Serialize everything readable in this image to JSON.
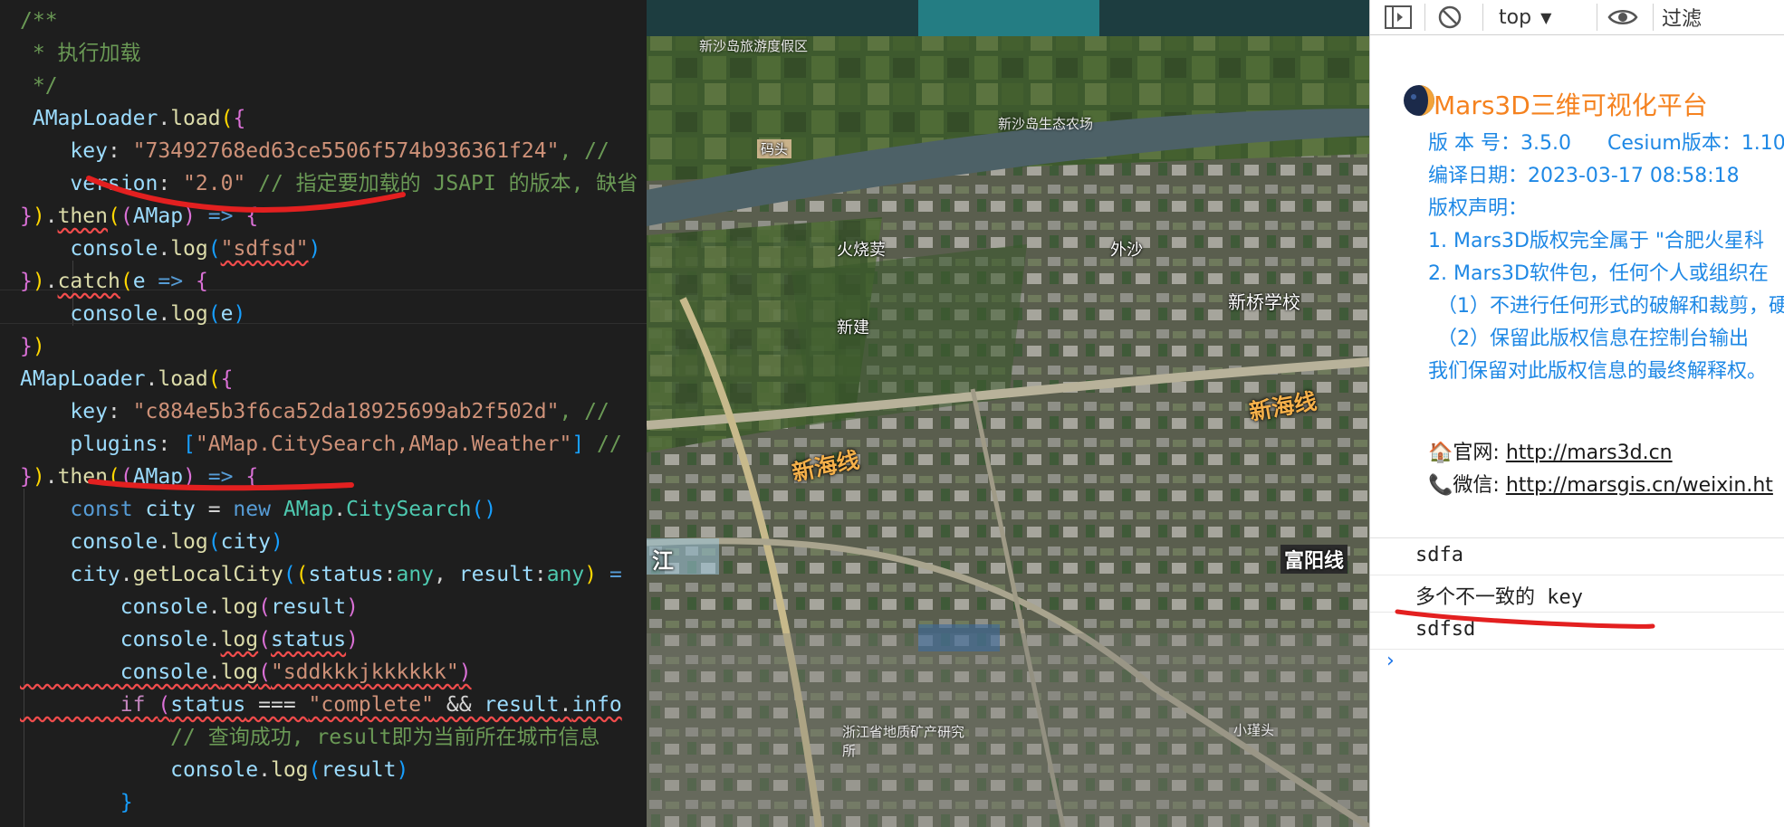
{
  "editor": {
    "lines": [
      [
        {
          "t": "/**",
          "c": "c-com"
        }
      ],
      [
        {
          "t": " * 执行加载",
          "c": "c-com"
        }
      ],
      [
        {
          "t": " */",
          "c": "c-com"
        }
      ],
      [
        {
          "t": " AMapLoader",
          "c": "c-var"
        },
        {
          "t": ".",
          "c": "c-op"
        },
        {
          "t": "load",
          "c": "c-fn"
        },
        {
          "t": "(",
          "c": "c-b1"
        },
        {
          "t": "{",
          "c": "c-b2"
        }
      ],
      [
        {
          "t": "    key",
          "c": "c-var"
        },
        {
          "t": ": ",
          "c": "c-op"
        },
        {
          "t": "\"73492768ed63ce5506f574b936361f24\"",
          "c": "c-str"
        },
        {
          "t": ", //",
          "c": "c-com"
        }
      ],
      [
        {
          "t": "    version",
          "c": "c-var"
        },
        {
          "t": ": ",
          "c": "c-op"
        },
        {
          "t": "\"2.0\"",
          "c": "c-str"
        },
        {
          "t": " // 指定要加载的 JSAPI 的版本, 缺省",
          "c": "c-com"
        }
      ],
      [
        {
          "t": "}",
          "c": "c-b2"
        },
        {
          "t": ")",
          "c": "c-b1"
        },
        {
          "t": ".",
          "c": "c-op"
        },
        {
          "t": "then",
          "c": "c-fn squig"
        },
        {
          "t": "(",
          "c": "c-b1"
        },
        {
          "t": "(",
          "c": "c-b2"
        },
        {
          "t": "AMap",
          "c": "c-var"
        },
        {
          "t": ")",
          "c": "c-b2"
        },
        {
          "t": " => ",
          "c": "c-kw"
        },
        {
          "t": "{",
          "c": "c-b2"
        }
      ],
      [
        {
          "t": "    console",
          "c": "c-var"
        },
        {
          "t": ".",
          "c": "c-op"
        },
        {
          "t": "log",
          "c": "c-fn"
        },
        {
          "t": "(",
          "c": "c-b3"
        },
        {
          "t": "\"sdfsd\"",
          "c": "c-str squig"
        },
        {
          "t": ")",
          "c": "c-b3"
        }
      ],
      [
        {
          "t": "}",
          "c": "c-b2"
        },
        {
          "t": ")",
          "c": "c-b1"
        },
        {
          "t": ".",
          "c": "c-op"
        },
        {
          "t": "catch",
          "c": "c-fn squig"
        },
        {
          "t": "(",
          "c": "c-b1"
        },
        {
          "t": "e",
          "c": "c-var"
        },
        {
          "t": " => ",
          "c": "c-kw"
        },
        {
          "t": "{",
          "c": "c-b2"
        }
      ],
      [
        {
          "t": "    console",
          "c": "c-var"
        },
        {
          "t": ".",
          "c": "c-op"
        },
        {
          "t": "log",
          "c": "c-fn"
        },
        {
          "t": "(",
          "c": "c-b3"
        },
        {
          "t": "e",
          "c": "c-var"
        },
        {
          "t": ")",
          "c": "c-b3"
        }
      ],
      [
        {
          "t": "}",
          "c": "c-b2"
        },
        {
          "t": ")",
          "c": "c-b1"
        }
      ],
      [
        {
          "t": "AMapLoader",
          "c": "c-var"
        },
        {
          "t": ".",
          "c": "c-op"
        },
        {
          "t": "load",
          "c": "c-fn"
        },
        {
          "t": "(",
          "c": "c-b1"
        },
        {
          "t": "{",
          "c": "c-b2"
        }
      ],
      [
        {
          "t": "    key",
          "c": "c-var"
        },
        {
          "t": ": ",
          "c": "c-op"
        },
        {
          "t": "\"c884e5b3f6ca52da18925699ab2f502d\"",
          "c": "c-str"
        },
        {
          "t": ", //",
          "c": "c-com"
        }
      ],
      [
        {
          "t": "    plugins",
          "c": "c-var"
        },
        {
          "t": ": ",
          "c": "c-op"
        },
        {
          "t": "[",
          "c": "c-b3"
        },
        {
          "t": "\"AMap.CitySearch,AMap.Weather\"",
          "c": "c-str"
        },
        {
          "t": "]",
          "c": "c-b3"
        },
        {
          "t": " //",
          "c": "c-com"
        }
      ],
      [
        {
          "t": "}",
          "c": "c-b2"
        },
        {
          "t": ")",
          "c": "c-b1"
        },
        {
          "t": ".",
          "c": "c-op"
        },
        {
          "t": "then",
          "c": "c-fn"
        },
        {
          "t": "(",
          "c": "c-b1"
        },
        {
          "t": "(",
          "c": "c-b2"
        },
        {
          "t": "AMap",
          "c": "c-var"
        },
        {
          "t": ")",
          "c": "c-b2"
        },
        {
          "t": " => ",
          "c": "c-kw"
        },
        {
          "t": "{",
          "c": "c-b2"
        }
      ],
      [
        {
          "t": "    const ",
          "c": "c-kw"
        },
        {
          "t": "city",
          "c": "c-var"
        },
        {
          "t": " = ",
          "c": "c-op"
        },
        {
          "t": "new ",
          "c": "c-kw"
        },
        {
          "t": "AMap",
          "c": "c-cls"
        },
        {
          "t": ".",
          "c": "c-op"
        },
        {
          "t": "CitySearch",
          "c": "c-cls"
        },
        {
          "t": "()",
          "c": "c-b3"
        }
      ],
      [
        {
          "t": "    console",
          "c": "c-var"
        },
        {
          "t": ".",
          "c": "c-op"
        },
        {
          "t": "log",
          "c": "c-fn"
        },
        {
          "t": "(",
          "c": "c-b3"
        },
        {
          "t": "city",
          "c": "c-var"
        },
        {
          "t": ")",
          "c": "c-b3"
        }
      ],
      [
        {
          "t": "    city",
          "c": "c-var"
        },
        {
          "t": ".",
          "c": "c-op"
        },
        {
          "t": "getLocalCity",
          "c": "c-fn"
        },
        {
          "t": "(",
          "c": "c-b3"
        },
        {
          "t": "(",
          "c": "c-b1"
        },
        {
          "t": "status",
          "c": "c-var"
        },
        {
          "t": ":",
          "c": "c-op"
        },
        {
          "t": "any",
          "c": "c-cls"
        },
        {
          "t": ", ",
          "c": "c-op"
        },
        {
          "t": "result",
          "c": "c-var"
        },
        {
          "t": ":",
          "c": "c-op"
        },
        {
          "t": "any",
          "c": "c-cls"
        },
        {
          "t": ")",
          "c": "c-b1"
        },
        {
          "t": " =",
          "c": "c-kw"
        }
      ],
      [
        {
          "t": "        console",
          "c": "c-var"
        },
        {
          "t": ".",
          "c": "c-op"
        },
        {
          "t": "log",
          "c": "c-fn"
        },
        {
          "t": "(",
          "c": "c-b2"
        },
        {
          "t": "result",
          "c": "c-var"
        },
        {
          "t": ")",
          "c": "c-b2"
        }
      ],
      [
        {
          "t": "        console",
          "c": "c-var"
        },
        {
          "t": ".",
          "c": "c-op"
        },
        {
          "t": "log",
          "c": "c-fn squig"
        },
        {
          "t": "(",
          "c": "c-b2"
        },
        {
          "t": "status",
          "c": "c-var squig"
        },
        {
          "t": ")",
          "c": "c-b2"
        }
      ],
      [
        {
          "t": "        console",
          "c": "c-var squig"
        },
        {
          "t": ".",
          "c": "c-op squig"
        },
        {
          "t": "log",
          "c": "c-fn squig"
        },
        {
          "t": "(",
          "c": "c-b2 squig"
        },
        {
          "t": "\"sddkkkjkkkkkk\"",
          "c": "c-str squig"
        },
        {
          "t": ")",
          "c": "c-b2 squig"
        }
      ],
      [
        {
          "t": "        if ",
          "c": "c-ctl squig"
        },
        {
          "t": "(",
          "c": "c-b2 squig"
        },
        {
          "t": "status",
          "c": "c-var squig"
        },
        {
          "t": " === ",
          "c": "c-op squig"
        },
        {
          "t": "\"complete\"",
          "c": "c-str squig"
        },
        {
          "t": " && ",
          "c": "c-op squig"
        },
        {
          "t": "result",
          "c": "c-var squig"
        },
        {
          "t": ".",
          "c": "c-op squig"
        },
        {
          "t": "info",
          "c": "c-var squig"
        }
      ],
      [
        {
          "t": "            // 查询成功, result即为当前所在城市信息",
          "c": "c-com"
        }
      ],
      [
        {
          "t": "            console",
          "c": "c-var"
        },
        {
          "t": ".",
          "c": "c-op"
        },
        {
          "t": "log",
          "c": "c-fn"
        },
        {
          "t": "(",
          "c": "c-b3"
        },
        {
          "t": "result",
          "c": "c-var"
        },
        {
          "t": ")",
          "c": "c-b3"
        }
      ],
      [
        {
          "t": "        }",
          "c": "c-b3"
        }
      ]
    ]
  },
  "map": {
    "labels": {
      "top_region": "新沙岛旅游度假区",
      "factory": "新沙岛生态农场",
      "torn_top": "码头",
      "huoshaoxiang": "火烧荬",
      "waisha": "外沙",
      "xinqiao_school": "新桥学校",
      "xinjian": "新建",
      "xinhai_line_right": "新海线",
      "xinhai_line_left": "新海线",
      "river_left": "江",
      "fuyang": "富阳线",
      "geology_institute": "浙江省地质矿产研究所",
      "xiaoguan": "小瑾头"
    }
  },
  "console": {
    "toolbar": {
      "context": "top",
      "filter_placeholder": "过滤"
    },
    "banner": {
      "title": "Mars3D三维可视化平台",
      "version": "版 本 号：3.5.0",
      "cesium": "Cesium版本：1.10",
      "build_date": "编译日期：2023-03-17 08:58:18",
      "copyright_head": "版权声明：",
      "line1": "1. Mars3D版权完全属于 \"合肥火星科",
      "line2": "2. Mars3D软件包，任何个人或组织在",
      "line2a": "（1）不进行任何形式的破解和裁剪，硬",
      "line2b": "（2）保留此版权信息在控制台输出",
      "line3": "我们保留对此版权信息的最终解释权。",
      "site_label": "🏠官网: ",
      "site_url": "http://mars3d.cn",
      "wechat_label": "📞微信: ",
      "wechat_url": "http://marsgis.cn/weixin.ht"
    },
    "messages": [
      "sdfa",
      "多个不一致的 key",
      "sdfsd"
    ],
    "prompt": "›"
  },
  "colors": {
    "annotation": "#e32020",
    "banner_orange": "#f5821f",
    "banner_blue": "#1e88e5"
  }
}
